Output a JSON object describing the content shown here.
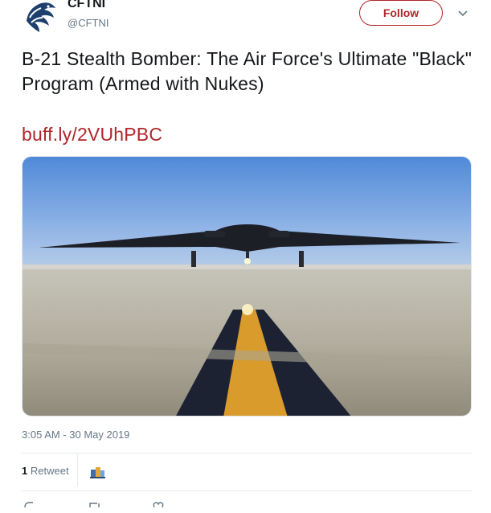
{
  "account": {
    "display_name": "CFTNI",
    "handle": "@CFTNI",
    "avatar_icon": "eagle-logo-icon",
    "brand_color": "#1d3f6e"
  },
  "follow_button": {
    "label": "Follow",
    "color": "#b0262a"
  },
  "menu_icon": "chevron-down-icon",
  "tweet": {
    "text": "B-21 Stealth Bomber: The Air Force's Ultimate \"Black\" Program (Armed with Nukes)",
    "link": "buff.ly/2VUhPBC",
    "link_color": "#b0262a"
  },
  "media": {
    "image_icon": "stealth-bomber-runway-photo"
  },
  "timestamp": "3:05 AM - 30 May 2019",
  "stats": {
    "retweets_count": "1",
    "retweets_label": "Retweet",
    "retweeter_avatar_icon": "retweeter-avatar-icon"
  },
  "actions": {
    "reply_icon": "reply-icon",
    "retweet_icon": "retweet-icon",
    "like_icon": "like-icon"
  }
}
